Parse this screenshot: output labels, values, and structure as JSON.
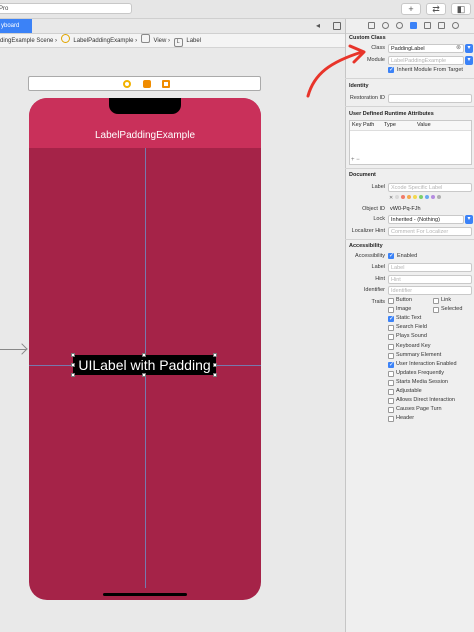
{
  "toolbar": {
    "scheme": "Pro",
    "add": "+",
    "swap": "⇄",
    "panel": "◧"
  },
  "editor": {
    "file_tab": "yboard",
    "breadcrumb": {
      "scene": "dingExample Scene",
      "controller": "LabelPaddingExample",
      "view": "View",
      "label": "Label"
    }
  },
  "canvas": {
    "nav_title": "LabelPaddingExample",
    "label_text": "UILabel with Padding"
  },
  "inspector": {
    "custom_class": {
      "section": "Custom Class",
      "class_label": "Class",
      "class_value": "PaddingLabel",
      "module_label": "Module",
      "module_placeholder": "LabelPaddingExample",
      "inherit_label": "Inherit Module From Target"
    },
    "identity": {
      "section": "Identity",
      "restoration_label": "Restoration ID"
    },
    "runtime": {
      "section": "User Defined Runtime Attributes",
      "col_keypath": "Key Path",
      "col_type": "Type",
      "col_value": "Value",
      "add_remove": "+  −"
    },
    "document": {
      "section": "Document",
      "label_label": "Label",
      "label_placeholder": "Xcode Specific Label",
      "object_id_label": "Object ID",
      "object_id_value": "vW0-Pq-FJh",
      "lock_label": "Lock",
      "lock_value": "Inherited - (Nothing)",
      "hint_label": "Localizer Hint",
      "hint_placeholder": "Comment For Localizer",
      "swatches": [
        "#d9d9d9",
        "#f07b6a",
        "#f5a94e",
        "#f3d84e",
        "#7ccf6b",
        "#6aa9f0",
        "#b58ce0",
        "#b0b0b0"
      ]
    },
    "accessibility": {
      "section": "Accessibility",
      "accessibility_label": "Accessibility",
      "enabled": "Enabled",
      "label_label": "Label",
      "label_placeholder": "Label",
      "hint_label": "Hint",
      "hint_placeholder": "Hint",
      "identifier_label": "Identifier",
      "identifier_placeholder": "Identifier",
      "traits_label": "Traits",
      "traits": [
        {
          "name": "Button",
          "checked": false
        },
        {
          "name": "Link",
          "checked": false
        },
        {
          "name": "Image",
          "checked": false
        },
        {
          "name": "Selected",
          "checked": false
        },
        {
          "name": "Static Text",
          "checked": true
        },
        {
          "name": "Search Field",
          "checked": false
        },
        {
          "name": "Plays Sound",
          "checked": false
        },
        {
          "name": "Keyboard Key",
          "checked": false
        },
        {
          "name": "Summary Element",
          "checked": false
        },
        {
          "name": "User Interaction Enabled",
          "checked": true
        },
        {
          "name": "Updates Frequently",
          "checked": false
        },
        {
          "name": "Starts Media Session",
          "checked": false
        },
        {
          "name": "Adjustable",
          "checked": false
        },
        {
          "name": "Allows Direct Interaction",
          "checked": false
        },
        {
          "name": "Causes Page Turn",
          "checked": false
        },
        {
          "name": "Header",
          "checked": false
        }
      ]
    }
  },
  "colors": {
    "accent": "#3b82f7",
    "nav": "#c9305a",
    "view": "#a52348",
    "arrow": "#e8342a"
  },
  "icons": [
    "left-arrow-icon",
    "view-controller-icon",
    "first-responder-icon",
    "exit-icon",
    "file-inspector-icon",
    "quick-help-icon",
    "identity-inspector-icon",
    "attributes-inspector-icon",
    "size-inspector-icon",
    "connections-inspector-icon"
  ]
}
